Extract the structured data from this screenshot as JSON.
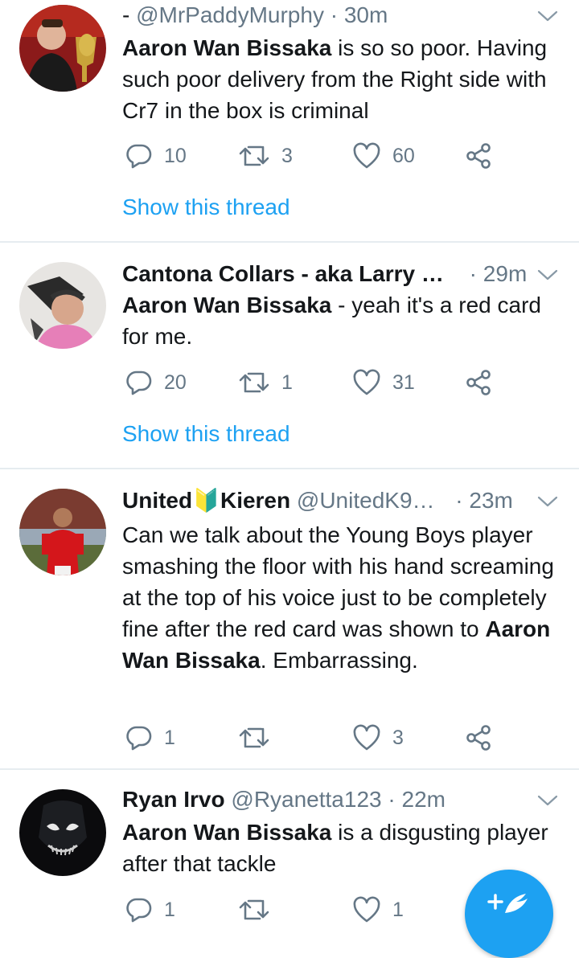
{
  "colors": {
    "accent": "#1da1f2",
    "muted": "#657786",
    "divider": "#e6ecf0"
  },
  "tweets": [
    {
      "prefix": "- ",
      "name": "",
      "handle": "@MrPaddyMurphy",
      "sep": " · ",
      "time": "30m",
      "text_parts": [
        {
          "bold": true,
          "t": "Aaron Wan Bissaka"
        },
        {
          "bold": false,
          "t": " is so so poor. Having such poor delivery from the Right side with Cr7 in the box is criminal"
        }
      ],
      "reply_count": "10",
      "retweet_count": "3",
      "like_count": "60",
      "thread_link": "Show this thread"
    },
    {
      "prefix": "",
      "name": "Cantona Collars - aka Larry …",
      "handle": "",
      "sep": " · ",
      "time": "29m",
      "text_parts": [
        {
          "bold": true,
          "t": "Aaron Wan Bissaka"
        },
        {
          "bold": false,
          "t": " - yeah it's a red card for me."
        }
      ],
      "reply_count": "20",
      "retweet_count": "1",
      "like_count": "31",
      "thread_link": "Show this thread"
    },
    {
      "prefix": "",
      "name": "United🔰Kieren",
      "handle": " @UnitedK9…",
      "sep": " · ",
      "time": "23m",
      "text_parts": [
        {
          "bold": false,
          "t": "Can we talk about the Young Boys player smashing the floor with his hand screaming at the top of his voice just to be completely fine after the red card was shown to "
        },
        {
          "bold": true,
          "t": "Aaron Wan Bissaka"
        },
        {
          "bold": false,
          "t": ". Embarrassing."
        }
      ],
      "reply_count": "1",
      "retweet_count": "",
      "like_count": "3",
      "thread_link": ""
    },
    {
      "prefix": "",
      "name": "Ryan Irvo",
      "handle": " @Ryanetta123",
      "sep": " · ",
      "time": "22m",
      "text_parts": [
        {
          "bold": true,
          "t": "Aaron Wan Bissaka"
        },
        {
          "bold": false,
          "t": " is a disgusting player after that tackle"
        }
      ],
      "reply_count": "1",
      "retweet_count": "",
      "like_count": "1",
      "thread_link": ""
    }
  ],
  "icons": {
    "reply": "reply-icon",
    "retweet": "retweet-icon",
    "like": "heart-icon",
    "share": "share-icon",
    "more": "chevron-down-icon",
    "compose": "compose-tweet-icon"
  }
}
